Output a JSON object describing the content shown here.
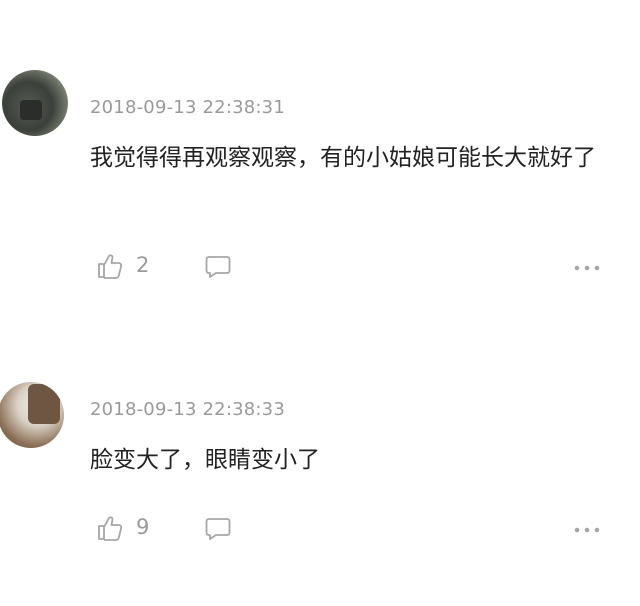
{
  "comments": [
    {
      "timestamp": "2018-09-13 22:38:31",
      "text": "我觉得得再观察观察，有的小姑娘可能长大就好了",
      "likes": "2",
      "icons": {
        "like": "thumbs-up-icon",
        "reply": "comment-bubble-icon",
        "more": "more-dots-icon"
      }
    },
    {
      "timestamp": "2018-09-13 22:38:33",
      "text": "脸变大了，眼睛变小了",
      "likes": "9",
      "icons": {
        "like": "thumbs-up-icon",
        "reply": "comment-bubble-icon",
        "more": "more-dots-icon"
      }
    }
  ],
  "colors": {
    "timestamp": "#9a9a9a",
    "text": "#222222",
    "icon": "#a6a6a6"
  }
}
